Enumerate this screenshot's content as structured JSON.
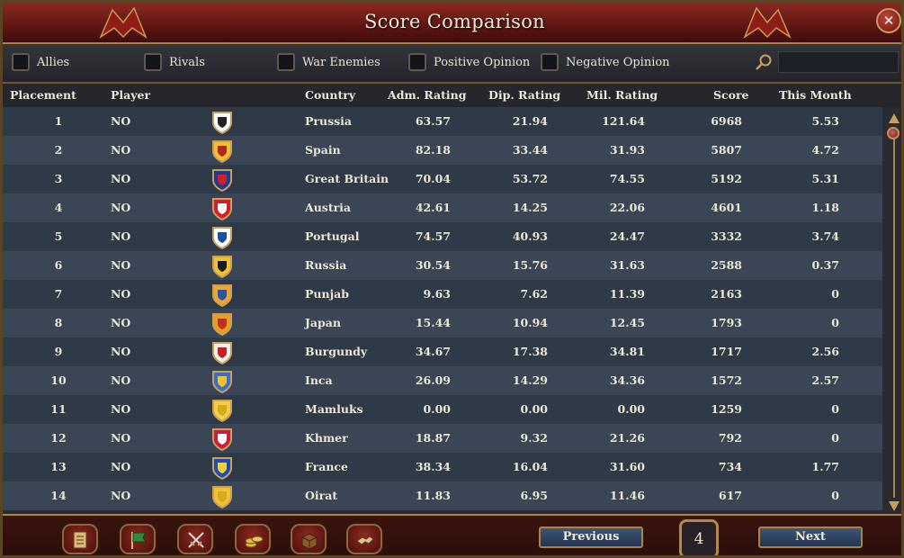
{
  "window": {
    "title": "Score Comparison",
    "close_icon": "close-icon"
  },
  "filters": [
    {
      "label": "Allies",
      "checked": false
    },
    {
      "label": "Rivals",
      "checked": false
    },
    {
      "label": "War Enemies",
      "checked": false
    },
    {
      "label": "Positive Opinion",
      "checked": false
    },
    {
      "label": "Negative Opinion",
      "checked": false
    }
  ],
  "search": {
    "value": "",
    "placeholder": ""
  },
  "columns": {
    "placement": "Placement",
    "player": "Player",
    "country": "Country",
    "adm": "Adm. Rating",
    "dip": "Dip. Rating",
    "mil": "Mil. Rating",
    "score": "Score",
    "month": "This Month"
  },
  "rows": [
    {
      "place": "1",
      "player": "NO",
      "flag": "prussia-flag-icon",
      "country": "Prussia",
      "adm": "63.57",
      "dip": "21.94",
      "mil": "121.64",
      "score": "6968",
      "month": "5.53"
    },
    {
      "place": "2",
      "player": "NO",
      "flag": "spain-flag-icon",
      "country": "Spain",
      "adm": "82.18",
      "dip": "33.44",
      "mil": "31.93",
      "score": "5807",
      "month": "4.72"
    },
    {
      "place": "3",
      "player": "NO",
      "flag": "great-britain-flag-icon",
      "country": "Great Britain",
      "adm": "70.04",
      "dip": "53.72",
      "mil": "74.55",
      "score": "5192",
      "month": "5.31"
    },
    {
      "place": "4",
      "player": "NO",
      "flag": "austria-flag-icon",
      "country": "Austria",
      "adm": "42.61",
      "dip": "14.25",
      "mil": "22.06",
      "score": "4601",
      "month": "1.18"
    },
    {
      "place": "5",
      "player": "NO",
      "flag": "portugal-flag-icon",
      "country": "Portugal",
      "adm": "74.57",
      "dip": "40.93",
      "mil": "24.47",
      "score": "3332",
      "month": "3.74"
    },
    {
      "place": "6",
      "player": "NO",
      "flag": "russia-flag-icon",
      "country": "Russia",
      "adm": "30.54",
      "dip": "15.76",
      "mil": "31.63",
      "score": "2588",
      "month": "0.37"
    },
    {
      "place": "7",
      "player": "NO",
      "flag": "punjab-flag-icon",
      "country": "Punjab",
      "adm": "9.63",
      "dip": "7.62",
      "mil": "11.39",
      "score": "2163",
      "month": "0"
    },
    {
      "place": "8",
      "player": "NO",
      "flag": "japan-flag-icon",
      "country": "Japan",
      "adm": "15.44",
      "dip": "10.94",
      "mil": "12.45",
      "score": "1793",
      "month": "0"
    },
    {
      "place": "9",
      "player": "NO",
      "flag": "burgundy-flag-icon",
      "country": "Burgundy",
      "adm": "34.67",
      "dip": "17.38",
      "mil": "34.81",
      "score": "1717",
      "month": "2.56"
    },
    {
      "place": "10",
      "player": "NO",
      "flag": "inca-flag-icon",
      "country": "Inca",
      "adm": "26.09",
      "dip": "14.29",
      "mil": "34.36",
      "score": "1572",
      "month": "2.57"
    },
    {
      "place": "11",
      "player": "NO",
      "flag": "mamluks-flag-icon",
      "country": "Mamluks",
      "adm": "0.00",
      "dip": "0.00",
      "mil": "0.00",
      "score": "1259",
      "month": "0"
    },
    {
      "place": "12",
      "player": "NO",
      "flag": "khmer-flag-icon",
      "country": "Khmer",
      "adm": "18.87",
      "dip": "9.32",
      "mil": "21.26",
      "score": "792",
      "month": "0"
    },
    {
      "place": "13",
      "player": "NO",
      "flag": "france-flag-icon",
      "country": "France",
      "adm": "38.34",
      "dip": "16.04",
      "mil": "31.60",
      "score": "734",
      "month": "1.77"
    },
    {
      "place": "14",
      "player": "NO",
      "flag": "oirat-flag-icon",
      "country": "Oirat",
      "adm": "11.83",
      "dip": "6.95",
      "mil": "11.46",
      "score": "617",
      "month": "0"
    }
  ],
  "flag_colors": {
    "prussia": [
      "#ffffff",
      "#222222"
    ],
    "spain": [
      "#f2c230",
      "#b3261e"
    ],
    "great-britain": [
      "#1f3a8a",
      "#cf1f2e"
    ],
    "austria": [
      "#d0202c",
      "#ffffff"
    ],
    "portugal": [
      "#ffffff",
      "#1d4fa0"
    ],
    "russia": [
      "#f2c230",
      "#1b1b1b"
    ],
    "punjab": [
      "#f0a62a",
      "#2557a8"
    ],
    "japan": [
      "#e8a020",
      "#c0301c"
    ],
    "burgundy": [
      "#f3f0e8",
      "#c0202a"
    ],
    "inca": [
      "#3b6fc4",
      "#f2c230"
    ],
    "mamluks": [
      "#f2d040",
      "#d8a820"
    ],
    "khmer": [
      "#c8203a",
      "#ffffff"
    ],
    "france": [
      "#1e4fae",
      "#f2d040"
    ],
    "oirat": [
      "#f2c230",
      "#d8a820"
    ]
  },
  "toolbar": [
    {
      "icon": "ledger-icon"
    },
    {
      "icon": "flag-icon"
    },
    {
      "icon": "crossed-swords-icon"
    },
    {
      "icon": "coins-icon"
    },
    {
      "icon": "trade-goods-icon"
    },
    {
      "icon": "handshake-icon"
    }
  ],
  "pagination": {
    "previous_label": "Previous",
    "next_label": "Next",
    "page": "4"
  },
  "accent": {
    "title_red": "#8b2a22",
    "gold": "#a98545",
    "row_dark": "#2f3a49",
    "row_light": "#3a4556"
  }
}
